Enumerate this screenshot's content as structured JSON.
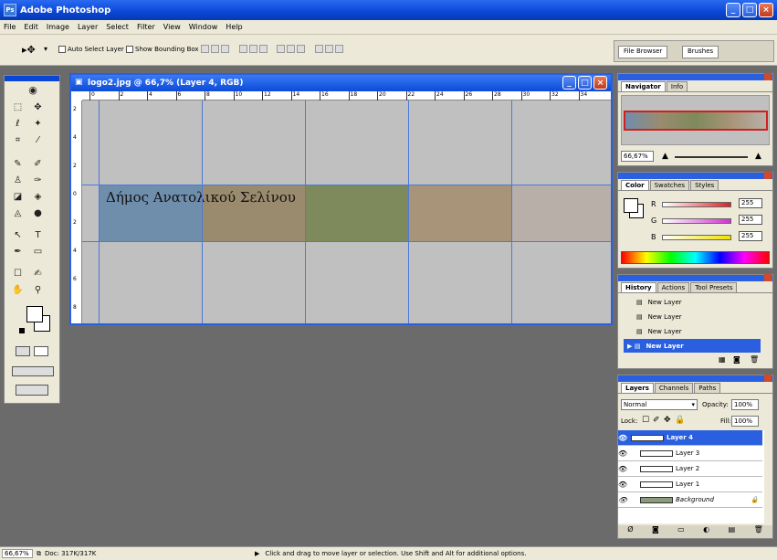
{
  "app": {
    "title": "Adobe Photoshop"
  },
  "menu": [
    "File",
    "Edit",
    "Image",
    "Layer",
    "Select",
    "Filter",
    "View",
    "Window",
    "Help"
  ],
  "options": {
    "auto_select": "Auto Select Layer",
    "show_bounding": "Show Bounding Box"
  },
  "palette_well": {
    "tabs": [
      "File Browser",
      "Brushes"
    ]
  },
  "document": {
    "title": "logo2.jpg @ 66,7% (Layer 4, RGB)",
    "ruler_h": [
      "0",
      "2",
      "4",
      "6",
      "8",
      "10",
      "12",
      "14",
      "16",
      "18",
      "20",
      "22",
      "24",
      "26",
      "28",
      "30",
      "32",
      "34"
    ],
    "ruler_v": [
      "2",
      "4",
      "2",
      "0",
      "2",
      "4",
      "6",
      "8"
    ],
    "banner_text": "Δήμος Ανατολικού Σελίνου",
    "banner_colors": [
      "#6f8eac",
      "#9a8b6e",
      "#7e8a5c",
      "#a89478",
      "#b8b0a8"
    ]
  },
  "navigator": {
    "tabs": [
      "Navigator",
      "Info"
    ],
    "zoom": "66,67%"
  },
  "color": {
    "tabs": [
      "Color",
      "Swatches",
      "Styles"
    ],
    "channels": [
      {
        "label": "R",
        "value": "255",
        "color": "#e02020"
      },
      {
        "label": "G",
        "value": "255",
        "color": "#d030d0"
      },
      {
        "label": "B",
        "value": "255",
        "color": "#f0e000"
      }
    ]
  },
  "history": {
    "tabs": [
      "History",
      "Actions",
      "Tool Presets"
    ],
    "items": [
      "New Layer",
      "New Layer",
      "New Layer",
      "New Layer"
    ]
  },
  "layers": {
    "tabs": [
      "Layers",
      "Channels",
      "Paths"
    ],
    "blend": "Normal",
    "opacity_label": "Opacity:",
    "opacity": "100%",
    "lock_label": "Lock:",
    "fill_label": "Fill:",
    "fill": "100%",
    "items": [
      "Layer 4",
      "Layer 3",
      "Layer 2",
      "Layer 1",
      "Background"
    ]
  },
  "status": {
    "zoom": "66,67%",
    "doc": "Doc: 317K/317K",
    "hint": "Click and drag to move layer or selection. Use Shift and Alt for additional options."
  }
}
